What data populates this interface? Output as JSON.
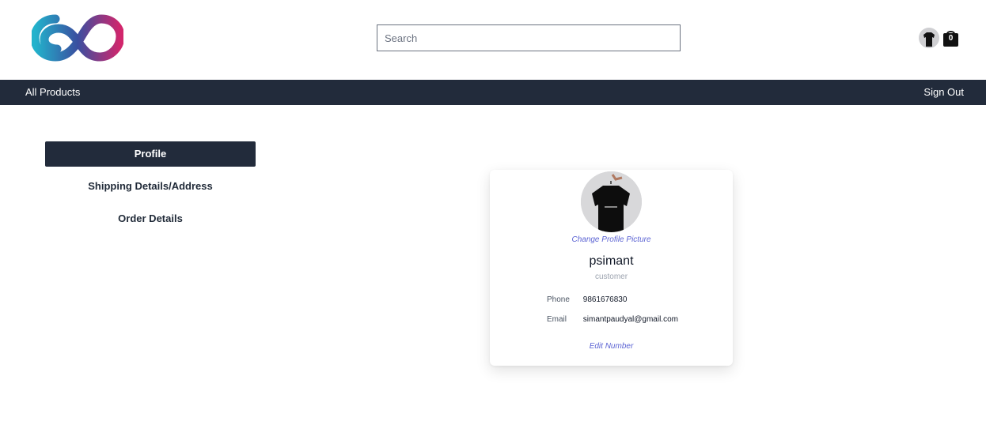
{
  "header": {
    "search": {
      "placeholder": "Search",
      "value": ""
    },
    "cart": {
      "count": "0"
    }
  },
  "navbar": {
    "all_products": "All Products",
    "sign_out": "Sign Out"
  },
  "sidebar": {
    "items": [
      {
        "label": "Profile",
        "active": true
      },
      {
        "label": "Shipping Details/Address",
        "active": false
      },
      {
        "label": "Order Details",
        "active": false
      }
    ]
  },
  "profile": {
    "change_picture": "Change Profile Picture",
    "username": "psimant",
    "role": "customer",
    "phone_label": "Phone",
    "phone": "9861676830",
    "email_label": "Email",
    "email": "simantpaudyal@gmail.com",
    "edit_number": "Edit Number"
  },
  "colors": {
    "navbar_bg": "#222b3b",
    "link_accent": "#5b63d3",
    "logo_teal": "#1fa3c4",
    "logo_magenta": "#c8246e"
  }
}
